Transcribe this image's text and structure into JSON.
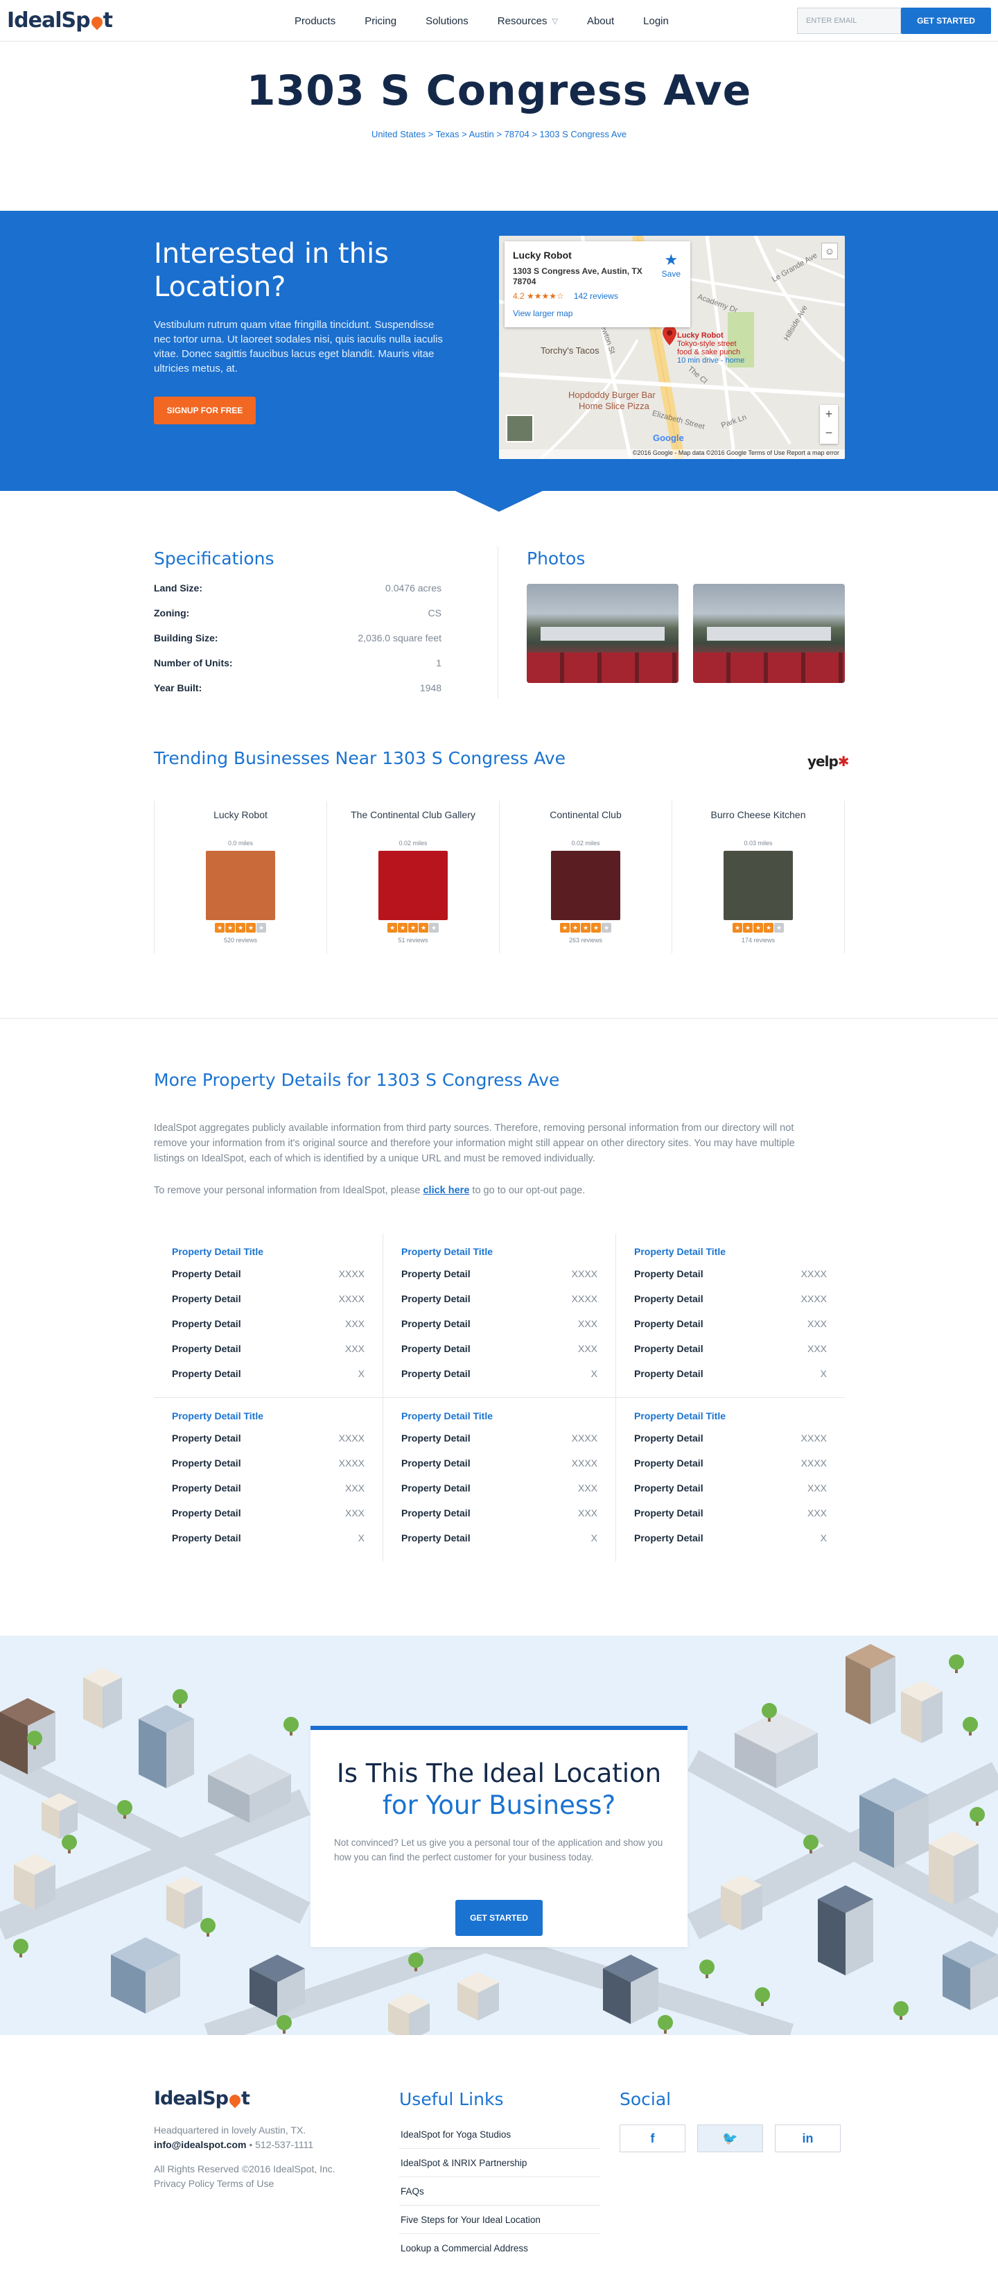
{
  "nav": {
    "brand": "IdealSpot",
    "links": [
      "Products",
      "Pricing",
      "Solutions",
      "Resources",
      "About",
      "Login"
    ],
    "email_placeholder": "ENTER EMAIL",
    "cta": "GET STARTED"
  },
  "hero": {
    "title": "1303 S Congress Ave",
    "breadcrumb": "United States > Texas > Austin > 78704 > 1303 S Congress Ave"
  },
  "interest": {
    "heading": "Interested in this Location?",
    "body": "Vestibulum rutrum quam vitae fringilla tincidunt. Suspendisse nec tortor urna. Ut laoreet sodales nisi, quis iaculis nulla iaculis vitae. Donec sagittis faucibus lacus eget blandit. Mauris vitae ultricies metus, at.",
    "button": "SIGNUP FOR FREE"
  },
  "map": {
    "place_name": "Lucky Robot",
    "address": "1303 S Congress Ave, Austin, TX 78704",
    "rating": "4.2 ★★★★☆",
    "reviews": "142 reviews",
    "larger_map": "View larger map",
    "save": "Save",
    "pin_name": "Lucky Robot",
    "pin_desc1": "Tokyo-style street",
    "pin_desc2": "food & sake punch",
    "pin_drive": "10 min drive - home",
    "labels": [
      "Torchy's Tacos",
      "Hopdoddy Burger Bar",
      "Home Slice Pizza",
      "Academy Dr",
      "Newton St",
      "Le Grande Ave",
      "Hillside Ave",
      "Elizabeth Street",
      "Park Ln",
      "The Cl"
    ],
    "google": "Google",
    "footer": "©2016 Google - Map data ©2016 Google   Terms of Use   Report a map error"
  },
  "specs": {
    "heading": "Specifications",
    "rows": [
      {
        "k": "Land Size:",
        "v": "0.0476 acres"
      },
      {
        "k": "Zoning:",
        "v": "CS"
      },
      {
        "k": "Building Size:",
        "v": "2,036.0 square feet"
      },
      {
        "k": "Number of Units:",
        "v": "1"
      },
      {
        "k": "Year Built:",
        "v": "1948"
      }
    ]
  },
  "photos": {
    "heading": "Photos"
  },
  "trending": {
    "heading": "Trending Businesses Near 1303 S Congress Ave",
    "yelp": "yelp",
    "items": [
      {
        "name": "Lucky Robot",
        "miles": "0.0 miles",
        "reviews": "520 reviews",
        "stars": 4,
        "color": "#c96a3a"
      },
      {
        "name": "The Continental Club Gallery",
        "miles": "0.02 miles",
        "reviews": "51 reviews",
        "stars": 4,
        "color": "#b8141d"
      },
      {
        "name": "Continental Club",
        "miles": "0.02 miles",
        "reviews": "263 reviews",
        "stars": 4,
        "color": "#5a1d22"
      },
      {
        "name": "Burro Cheese Kitchen",
        "miles": "0.03 miles",
        "reviews": "174 reviews",
        "stars": 4,
        "color": "#4a4f44"
      }
    ]
  },
  "details": {
    "heading": "More Property Details for 1303 S Congress Ave",
    "para": "IdealSpot aggregates publicly available information from third party sources. Therefore, removing personal information from our directory will not remove your information from it's original source and therefore your information might still appear on other directory sites. You may have multiple listings on IdealSpot, each of which is identified by a unique URL and must be removed individually.",
    "para2_pre": "To remove your personal information from IdealSpot, please ",
    "para2_link": "click here",
    "para2_post": " to go to our opt-out page.",
    "block_title": "Property Detail Title",
    "row_label": "Property Detail",
    "values": [
      "XXXX",
      "XXXX",
      "XXX",
      "XXX",
      "X"
    ]
  },
  "cta": {
    "line1": "Is This The Ideal Location",
    "line2": "for Your Business?",
    "body": "Not convinced? Let us give you a personal tour of the application and show you how you can find the perfect customer for your business today.",
    "button": "GET STARTED"
  },
  "footer": {
    "brand": "IdealSpot",
    "hq": "Headquartered in lovely Austin, TX.",
    "email": "info@idealspot.com",
    "phone": " • 512-537-1111",
    "rights": "All Rights Reserved ©2016 IdealSpot, Inc.",
    "policy": "Privacy Policy Terms of Use",
    "useful_heading": "Useful Links",
    "links": [
      "IdealSpot for Yoga Studios",
      "IdealSpot & INRIX Partnership",
      "FAQs",
      "Five Steps for Your Ideal Location",
      "Lookup a Commercial Address"
    ],
    "social_heading": "Social",
    "social": [
      {
        "icon": "facebook-icon",
        "glyph": "f"
      },
      {
        "icon": "twitter-icon",
        "glyph": "🐦"
      },
      {
        "icon": "linkedin-icon",
        "glyph": "in"
      }
    ]
  }
}
